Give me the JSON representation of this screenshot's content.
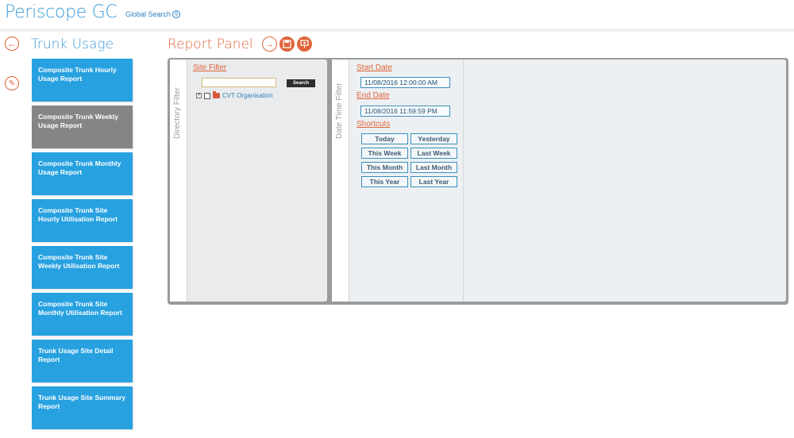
{
  "header": {
    "app_title": "Periscope GC",
    "global_search_label": "Global Search"
  },
  "sidebar": {
    "title": "Trunk Usage",
    "reports": [
      {
        "label": "Composite Trunk Hourly Usage Report",
        "selected": false
      },
      {
        "label": "Composite Trunk Weekly Usage Report",
        "selected": true
      },
      {
        "label": "Composite Trunk Monthly Usage Report",
        "selected": false
      },
      {
        "label": "Composite Trunk Site Hourly Utilisation Report",
        "selected": false
      },
      {
        "label": "Composite Trunk Site Weekly Utilisation Report",
        "selected": false
      },
      {
        "label": "Composite Trunk Site Monthly Utilisation Report",
        "selected": false
      },
      {
        "label": "Trunk Usage Site Detail Report",
        "selected": false
      },
      {
        "label": "Trunk Usage Site Summary Report",
        "selected": false
      }
    ]
  },
  "panel": {
    "title": "Report Panel",
    "directory_filter": {
      "tab_label": "Directory Filter",
      "site_filter_label": "Site Filter",
      "site_input_value": "",
      "search_label": "Search",
      "tree": [
        {
          "label": "CVT Organisation",
          "expander": "+",
          "checked": false
        }
      ]
    },
    "datetime_filter": {
      "tab_label": "Date Time Filter",
      "start_date_label": "Start Date",
      "start_date_value": "11/08/2016 12:00:00 AM",
      "end_date_label": "End Date",
      "end_date_value": "11/08/2016 11:59:59 PM",
      "shortcuts_label": "Shortcuts",
      "shortcuts": [
        "Today",
        "Yesterday",
        "This Week",
        "Last Week",
        "This Month",
        "Last Month",
        "This Year",
        "Last Year"
      ]
    }
  },
  "colors": {
    "brand_blue": "#3a9ad9",
    "accent_orange": "#e0643a",
    "tile_blue": "#27a1e0",
    "tile_selected": "#858585"
  },
  "icons": {
    "back": "arrow-left-icon",
    "edit": "pencil-icon",
    "run": "arrow-right-icon",
    "save": "save-icon",
    "schedule": "presentation-icon",
    "search": "magnifier-icon"
  }
}
